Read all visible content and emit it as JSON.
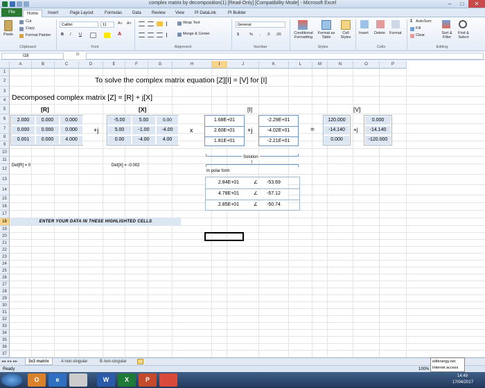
{
  "window": {
    "title": "complex matrix by decomposition(1)  [Read-Only]  [Compatibility Mode]  -  Microsoft Excel",
    "minimize": "–",
    "maximize": "□",
    "close": "✕"
  },
  "ribbon_tabs": [
    "File",
    "Home",
    "Insert",
    "Page Layout",
    "Formulas",
    "Data",
    "Review",
    "View",
    "PI DataLink",
    "PI Builder"
  ],
  "clipboard": {
    "paste": "Paste",
    "cut": "Cut",
    "copy": "Copy",
    "format_painter": "Format Painter",
    "group": "Clipboard"
  },
  "font": {
    "name": "Calibri",
    "size": "11",
    "bold": "B",
    "italic": "I",
    "underline": "U",
    "grow": "A˄",
    "shrink": "A˅",
    "color": "A",
    "group": "Font"
  },
  "alignment": {
    "wrap": "Wrap Text",
    "merge": "Merge & Center",
    "group": "Alignment"
  },
  "number": {
    "format": "General",
    "currency": "$",
    "percent": "%",
    "comma": ",",
    "inc_dec": ".0",
    "dec_dec": ".00",
    "group": "Number"
  },
  "styles": {
    "conditional": "Conditional Formatting",
    "format_table": "Format as Table",
    "cell_styles": "Cell Styles",
    "group": "Styles"
  },
  "cells": {
    "insert": "Insert",
    "delete": "Delete",
    "format": "Format",
    "group": "Cells"
  },
  "editing": {
    "autosum": "AutoSum",
    "fill": "Fill",
    "clear": "Clear",
    "sort": "Sort & Filter",
    "find": "Find & Select",
    "group": "Editing"
  },
  "formula_bar": {
    "name_box": "I18",
    "fx": "fx",
    "value": ""
  },
  "columns": [
    "A",
    "B",
    "C",
    "D",
    "E",
    "F",
    "G",
    "H",
    "I",
    "J",
    "K",
    "L",
    "M",
    "N",
    "O",
    "P"
  ],
  "rows": [
    "1",
    "2",
    "3",
    "4",
    "5",
    "6",
    "7",
    "8",
    "9",
    "10",
    "11",
    "12",
    "13",
    "14",
    "15",
    "16",
    "17",
    "18",
    "19",
    "20",
    "21",
    "22",
    "23",
    "24",
    "25",
    "26",
    "27",
    "28",
    "29",
    "30",
    "31",
    "32",
    "33",
    "34",
    "35",
    "36",
    "37",
    "38",
    "39",
    "40",
    "41"
  ],
  "sheet": {
    "title": "To solve the complex matrix equation   [Z][I] = [V]  for [I]",
    "subtitle": "Decomposed complex matrix [Z] = [R] + j[X]",
    "r_label": "[R]",
    "x_label": "[X]",
    "i_label": "[I]",
    "v_label": "[V]",
    "plus_j": "+j",
    "times": "x",
    "equals": "=",
    "R": [
      [
        "2.000",
        "0.000",
        "0.000"
      ],
      [
        "0.000",
        "0.000",
        "0.000"
      ],
      [
        "0.001",
        "0.000",
        "4.000"
      ]
    ],
    "X": [
      [
        "-5.00",
        "5.00",
        "0.00"
      ],
      [
        "5.00",
        "-1.00",
        "-4.00"
      ],
      [
        "0.00",
        "-4.00",
        "4.00"
      ]
    ],
    "I_re": [
      "1.68E+01",
      "2.60E+01",
      "1.81E+01"
    ],
    "I_im": [
      "-2.29E+01",
      "-4.02E+01",
      "-2.21E+01"
    ],
    "V_re": [
      "120.000",
      "-14.140",
      "0.000"
    ],
    "V_im": [
      "0.000",
      "-14.140",
      "-120.000"
    ],
    "det_r": "Det[R] = 0",
    "det_x": "Det[X] = -0.002",
    "solution": "Solution",
    "polar": "In polar form",
    "polar_mag": [
      "2.84E+01",
      "4.78E+01",
      "2.85E+01"
    ],
    "polar_ang": [
      "-53.69",
      "-57.12",
      "-50.74"
    ],
    "angle_sym": "∠",
    "banner": "ENTER YOUR DATA IN THESE HIGHLIGHTED CELLS"
  },
  "sheet_tabs": [
    "3x3 matrix",
    "A non-singular",
    "B non-singular"
  ],
  "status": {
    "ready": "Ready",
    "zoom": "100%"
  },
  "taskbar": {
    "time": "14:49",
    "date": "17/04/2017",
    "tooltip1": "edfenergy.net",
    "tooltip2": "Internet access"
  }
}
